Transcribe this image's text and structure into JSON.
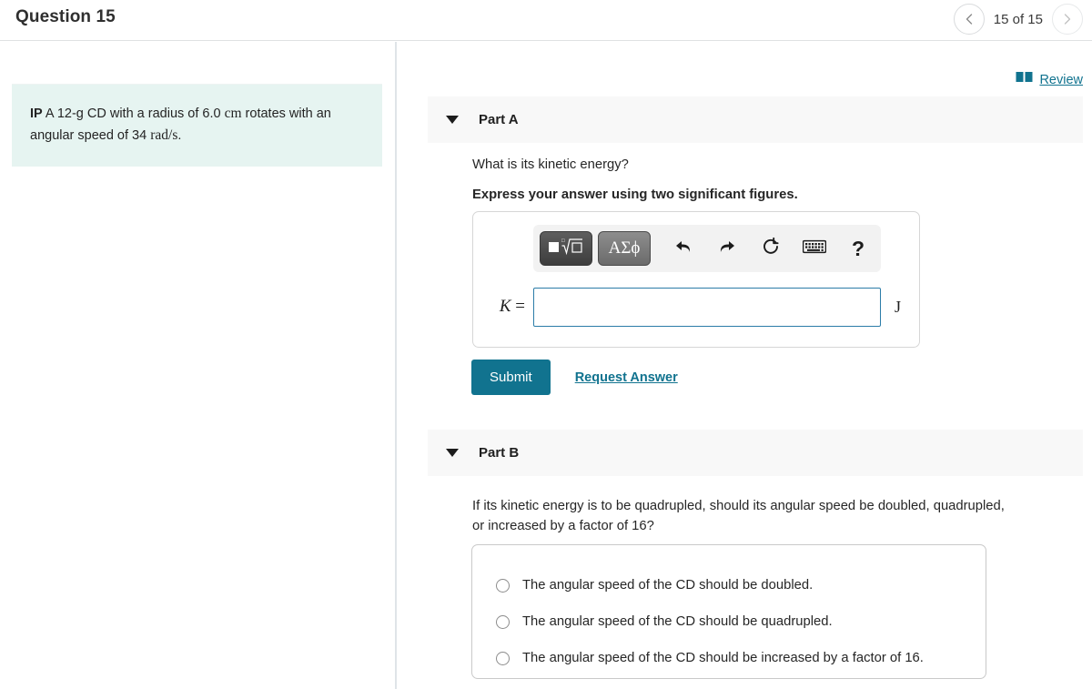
{
  "header": {
    "title": "Question 15",
    "nav": {
      "prev_icon": "chevron-left-icon",
      "next_icon": "chevron-right-icon",
      "counter": "15 of 15"
    }
  },
  "stem": {
    "prefix": "IP",
    "text_1": " A 12-g CD with a radius of 6.0 ",
    "unit_1": "cm",
    "text_2": " rotates with an angular speed of 34 ",
    "unit_2": "rad/s",
    "text_3": "."
  },
  "review": {
    "icon": "book-icon",
    "label": "Review"
  },
  "parts": {
    "a": {
      "caret_icon": "caret-down-icon",
      "label": "Part A",
      "question": "What is its kinetic energy?",
      "instruction": "Express your answer using two significant figures.",
      "math_toolbar": {
        "template_button": "template-radical-icon",
        "greek_button": "ΑΣϕ",
        "undo_icon": "undo-arrow-icon",
        "redo_icon": "redo-arrow-icon",
        "reset_icon": "reset-circle-icon",
        "keyboard_icon": "keyboard-icon",
        "help_icon": "?"
      },
      "answer": {
        "symbol": "K",
        "equals": "=",
        "value": "",
        "placeholder": "",
        "unit": "J"
      },
      "submit_label": "Submit",
      "request_answer_label": "Request Answer"
    },
    "b": {
      "caret_icon": "caret-down-icon",
      "label": "Part B",
      "question": "If its kinetic energy is to be quadrupled, should its angular speed be doubled, quadrupled, or increased by a factor of 16?",
      "options": [
        {
          "label": "The angular speed of the CD should be doubled.",
          "selected": false
        },
        {
          "label": "The angular speed of the CD should be quadrupled.",
          "selected": false
        },
        {
          "label": "The angular speed of the CD should be increased by a factor of 16.",
          "selected": false
        }
      ]
    }
  },
  "colors": {
    "accent": "#11738f",
    "stem_background": "#e6f4f1",
    "part_header_background": "#f8f8f8",
    "input_border": "#2b7ca8"
  }
}
